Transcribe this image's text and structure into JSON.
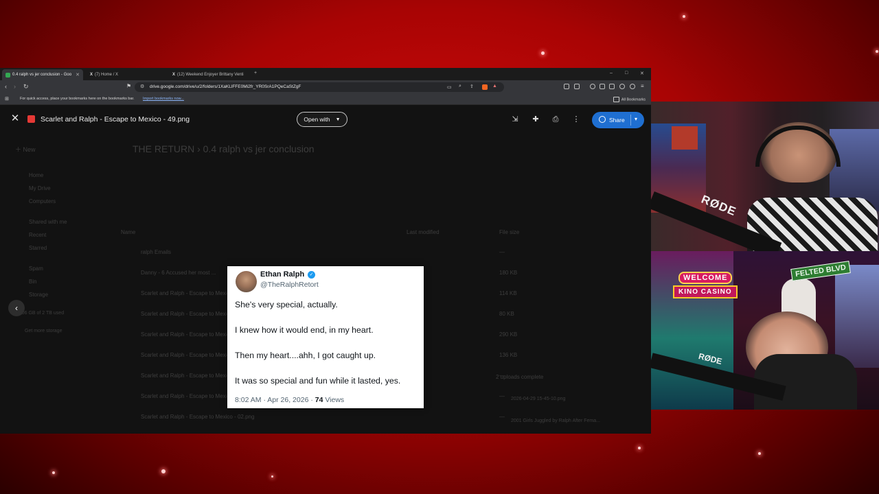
{
  "browser": {
    "tabs": [
      {
        "title": "0.4 ralph vs jer conclusion - Goo",
        "active": true
      },
      {
        "title": "(7) Home / X",
        "active": false
      },
      {
        "title": "(12) Weekend Enjoyer Brittany Venti",
        "active": false
      }
    ],
    "url": "drive.google.com/drive/u/2/folders/1XaKLlFFE0Mi2fr_YR0SrA1PQeCaStZgF",
    "bookmarks_hint": "For quick access, place your bookmarks here on the bookmarks bar.",
    "bookmarks_link": "Import bookmarks now...",
    "all_bookmarks": "All Bookmarks"
  },
  "viewer": {
    "filename": "Scarlet and Ralph - Escape to Mexico - 49.png",
    "open_with": "Open with",
    "share": "Share"
  },
  "drive_background": {
    "breadcrumb": "THE RETURN  ›  0.4 ralph vs jer conclusion",
    "new_label": "New",
    "sidebar": [
      "Home",
      "My Drive",
      "Computers",
      "Shared with me",
      "Recent",
      "Starred",
      "Spam",
      "Bin",
      "Storage"
    ],
    "storage": "10.06 GB of 2 TB used",
    "get_storage": "Get more storage",
    "col_name": "Name",
    "col_modified": "Last modified",
    "col_size": "File size",
    "files": [
      {
        "name": "ralph Emails",
        "size": "—"
      },
      {
        "name": "Danny - 6 Accused her most ...",
        "size": "180 KB"
      },
      {
        "name": "Scarlet and Ralph - Escape to Mexico - 08.png",
        "size": "114 KB"
      },
      {
        "name": "Scarlet and Ralph - Escape to Mexico - 07.png",
        "size": "80 KB"
      },
      {
        "name": "Scarlet and Ralph - Escape to Mexico - 06.png",
        "size": "290 KB"
      },
      {
        "name": "Scarlet and Ralph - Escape to Mexico - 04.png",
        "size": "136 KB"
      },
      {
        "name": "Scarlet and Ralph - Escape to Mexico - 05.png",
        "size": "—"
      },
      {
        "name": "Scarlet and Ralph - Escape to Mexico - 03.png",
        "size": "—"
      },
      {
        "name": "Scarlet and Ralph - Escape to Mexico - 02.png",
        "size": "—"
      }
    ],
    "uploads_title": "2 uploads complete",
    "uploads": [
      "2026-04-29 15-45-10.png",
      "2001 Girls Juggled by Ralph After Fema..."
    ]
  },
  "tweet": {
    "name": "Ethan Ralph",
    "handle": "@TheRalphRetort",
    "lines": [
      "She's very special, actually.",
      "I knew how it would end, in my heart.",
      "Then my heart....ahh, I got caught up.",
      "It was so special and fun while it lasted, yes."
    ],
    "time": "8:02 AM · Apr 26, 2026 · ",
    "views_count": "74",
    "views_label": " Views"
  },
  "overlay": {
    "mic_brand_1": "RØDE",
    "mic_brand_2": "RØDE",
    "sign_welcome": "WELCOME",
    "sign_casino": "KINO CASINO",
    "sign_street": "FELTED BLVD"
  },
  "colors": {
    "share_button": "#1f6fd1",
    "stream_background": "#c40808",
    "verified_badge": "#1d9bf0"
  }
}
